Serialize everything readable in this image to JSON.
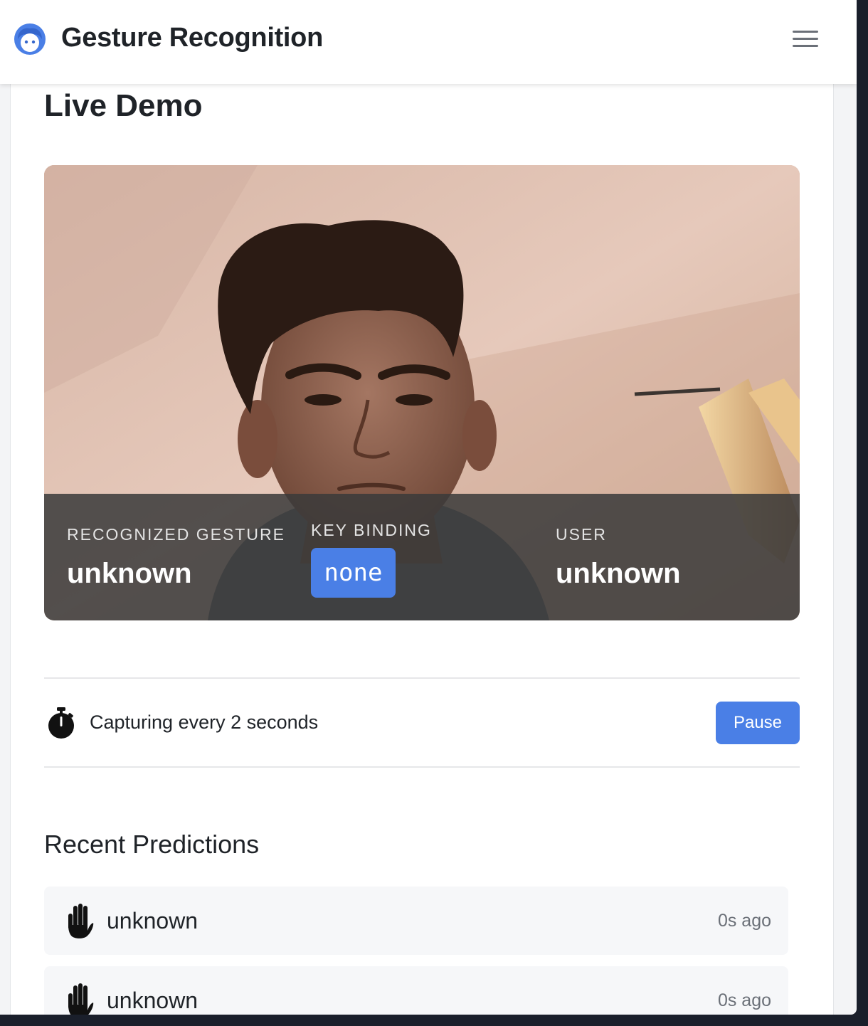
{
  "header": {
    "title": "Gesture Recognition",
    "logo_icon": "face-logo-icon",
    "menu_icon": "hamburger-menu-icon"
  },
  "page": {
    "title": "Live Demo"
  },
  "overlay": {
    "gesture_label": "RECOGNIZED GESTURE",
    "gesture_value": "unknown",
    "key_label": "KEY BINDING",
    "key_value": "none",
    "user_label": "USER",
    "user_value": "unknown"
  },
  "capture": {
    "icon": "stopwatch-icon",
    "text": "Capturing every 2 seconds",
    "pause_label": "Pause"
  },
  "predictions": {
    "title": "Recent Predictions",
    "items": [
      {
        "icon": "raised-hand-icon",
        "name": "unknown",
        "time": "0s ago"
      },
      {
        "icon": "raised-hand-icon",
        "name": "unknown",
        "time": "0s ago"
      }
    ]
  },
  "colors": {
    "accent": "#4a7fe6",
    "text": "#1f2328",
    "muted": "#6b7078"
  }
}
